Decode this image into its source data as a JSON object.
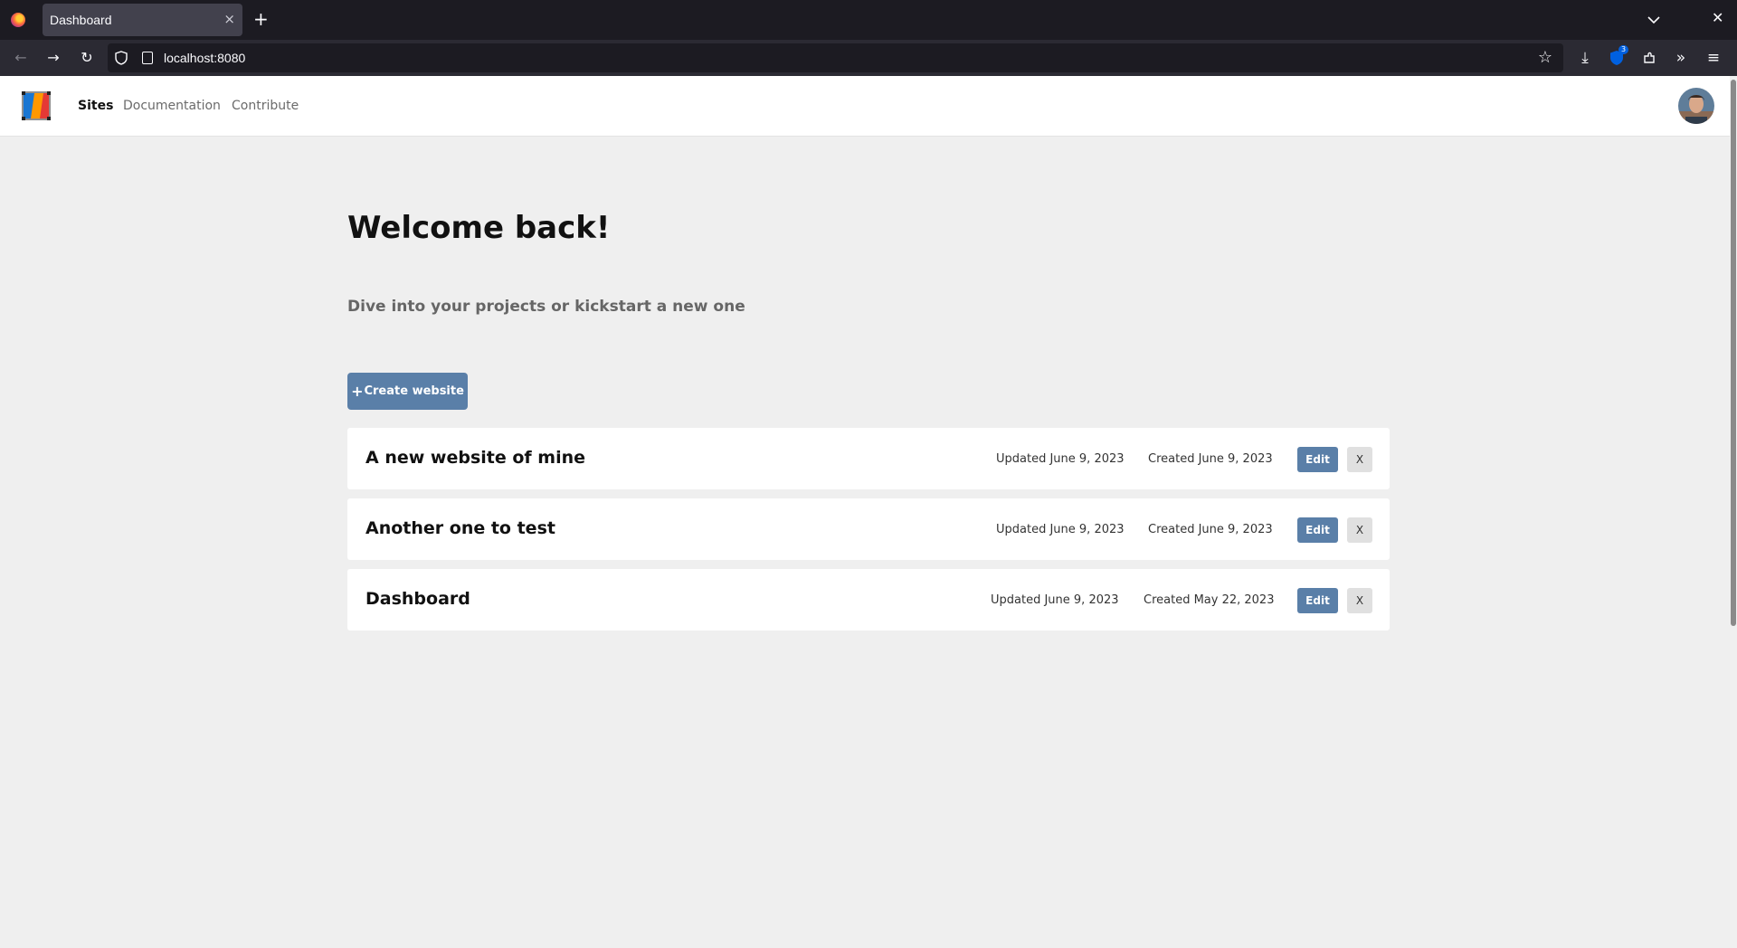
{
  "browser": {
    "tab_title": "Dashboard",
    "tab_close": "×",
    "new_tab": "+",
    "url": "localhost:8080",
    "extension_badge": "3",
    "window_close": "✕"
  },
  "header": {
    "nav": [
      {
        "label": "Sites",
        "active": true
      },
      {
        "label": "Documentation",
        "active": false
      },
      {
        "label": "Contribute",
        "active": false
      }
    ]
  },
  "main": {
    "title": "Welcome back!",
    "subtitle": "Dive into your projects or kickstart a new one",
    "create_plus": "+",
    "create_label": "Create website",
    "sites": [
      {
        "name": "A new website of mine",
        "updated": "Updated June 9, 2023",
        "created": "Created June 9, 2023",
        "edit": "Edit",
        "delete": "X"
      },
      {
        "name": "Another one to test",
        "updated": "Updated June 9, 2023",
        "created": "Created June 9, 2023",
        "edit": "Edit",
        "delete": "X"
      },
      {
        "name": "Dashboard",
        "updated": "Updated June 9, 2023",
        "created": "Created May 22, 2023",
        "edit": "Edit",
        "delete": "X"
      }
    ]
  },
  "colors": {
    "accent": "#5a7fa8",
    "page_bg": "#efefef",
    "chrome_dark": "#1c1b22"
  }
}
